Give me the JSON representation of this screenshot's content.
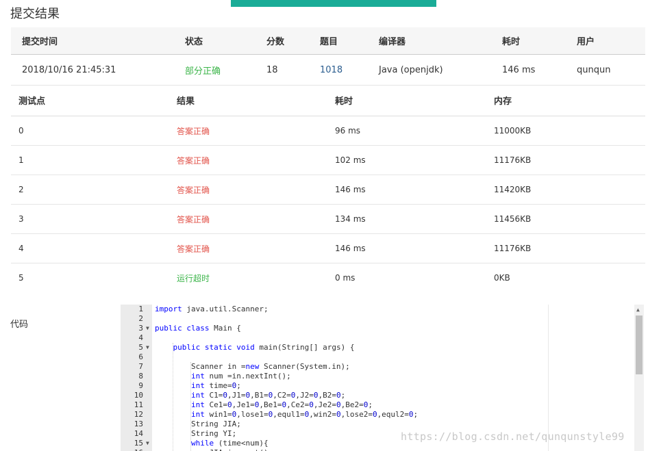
{
  "page_title": "提交结果",
  "submission": {
    "headers": [
      "提交时间",
      "状态",
      "分数",
      "题目",
      "编译器",
      "耗时",
      "用户"
    ],
    "row": {
      "time": "2018/10/16 21:45:31",
      "status": "部分正确",
      "score": "18",
      "problem": "1018",
      "compiler": "Java (openjdk)",
      "elapsed": "146 ms",
      "user": "qunqun"
    }
  },
  "cases": {
    "headers": [
      "测试点",
      "结果",
      "耗时",
      "内存"
    ],
    "rows": [
      {
        "id": "0",
        "result": "答案正确",
        "status": "ok",
        "time": "96 ms",
        "memory": "11000KB"
      },
      {
        "id": "1",
        "result": "答案正确",
        "status": "ok",
        "time": "102 ms",
        "memory": "11176KB"
      },
      {
        "id": "2",
        "result": "答案正确",
        "status": "ok",
        "time": "146 ms",
        "memory": "11420KB"
      },
      {
        "id": "3",
        "result": "答案正确",
        "status": "ok",
        "time": "134 ms",
        "memory": "11456KB"
      },
      {
        "id": "4",
        "result": "答案正确",
        "status": "ok",
        "time": "146 ms",
        "memory": "11176KB"
      },
      {
        "id": "5",
        "result": "运行超时",
        "status": "timeout",
        "time": "0 ms",
        "memory": "0KB"
      }
    ]
  },
  "code_label": "代码",
  "code_lines": [
    "import java.util.Scanner;",
    "",
    "public class Main {",
    "",
    "    public static void main(String[] args) {",
    "",
    "        Scanner in =new Scanner(System.in);",
    "        int num =in.nextInt();",
    "        int time=0;",
    "        int C1=0,J1=0,B1=0,C2=0,J2=0,B2=0;",
    "        int Ce1=0,Je1=0,Be1=0,Ce2=0,Je2=0,Be2=0;",
    "        int win1=0,lose1=0,equl1=0,win2=0,lose2=0,equl2=0;",
    "        String JIA;",
    "        String YI;",
    "        while (time<num){",
    "            JIA=in.next();"
  ],
  "fold_lines": [
    3,
    5,
    15
  ],
  "watermark": "https://blog.csdn.net/qunqunstyle99",
  "colors": {
    "accent": "#1aac97",
    "partial": "#3cb54a",
    "correct": "#e2544b",
    "link": "#2b5d8f"
  }
}
